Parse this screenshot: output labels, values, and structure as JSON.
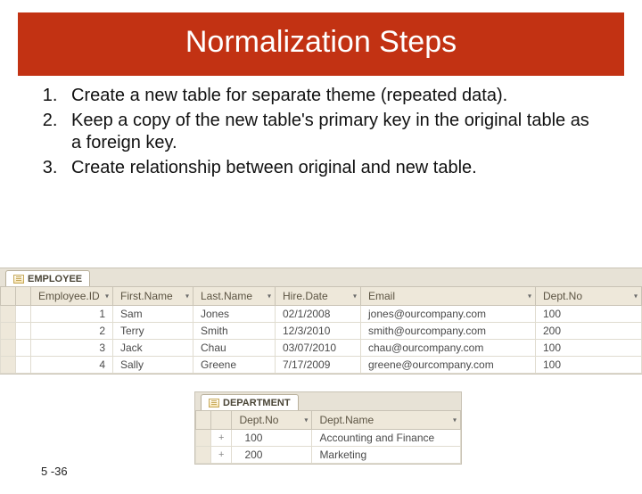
{
  "title": "Normalization Steps",
  "steps": [
    "Create a new table for separate theme (repeated data).",
    "Keep a copy of the new table's primary key in the original table as a foreign key.",
    "Create relationship between original and new table."
  ],
  "employee_table": {
    "tab": "EMPLOYEE",
    "columns": [
      "Employee.ID",
      "First.Name",
      "Last.Name",
      "Hire.Date",
      "Email",
      "Dept.No"
    ],
    "rows": [
      {
        "id": "1",
        "first": "Sam",
        "last": "Jones",
        "hire": "02/1/2008",
        "email": "jones@ourcompany.com",
        "dept": "100"
      },
      {
        "id": "2",
        "first": "Terry",
        "last": "Smith",
        "hire": "12/3/2010",
        "email": "smith@ourcompany.com",
        "dept": "200"
      },
      {
        "id": "3",
        "first": "Jack",
        "last": "Chau",
        "hire": "03/07/2010",
        "email": "chau@ourcompany.com",
        "dept": "100"
      },
      {
        "id": "4",
        "first": "Sally",
        "last": "Greene",
        "hire": "7/17/2009",
        "email": "greene@ourcompany.com",
        "dept": "100"
      }
    ]
  },
  "department_table": {
    "tab": "DEPARTMENT",
    "columns": [
      "Dept.No",
      "Dept.Name"
    ],
    "rows": [
      {
        "no": "100",
        "name": "Accounting and Finance"
      },
      {
        "no": "200",
        "name": "Marketing"
      }
    ]
  },
  "slide_number": "5 -36"
}
